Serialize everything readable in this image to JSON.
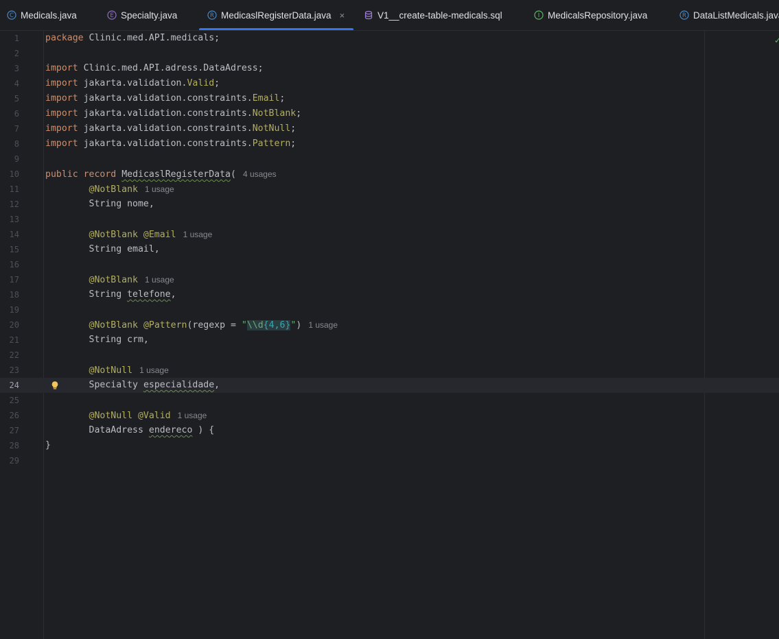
{
  "tabs": [
    {
      "label": "Medicals.java",
      "icon": "class-icon",
      "color": "#4a88c7"
    },
    {
      "label": "Specialty.java",
      "icon": "enum-icon",
      "color": "#8e6fc2"
    },
    {
      "label": "MedicaslRegisterData.java",
      "icon": "record-icon",
      "color": "#4a88c7",
      "active": true,
      "close": "×"
    },
    {
      "label": "V1__create-table-medicals.sql",
      "icon": "database-icon",
      "color": "#9b7ed1"
    },
    {
      "label": "MedicalsRepository.java",
      "icon": "interface-icon",
      "color": "#5fb865"
    },
    {
      "label": "DataListMedicals.java",
      "icon": "record-icon",
      "color": "#4a88c7"
    }
  ],
  "editor": {
    "current_line": 24,
    "line_numbers": [
      "1",
      "2",
      "3",
      "4",
      "5",
      "6",
      "7",
      "8",
      "9",
      "10",
      "11",
      "12",
      "13",
      "14",
      "15",
      "16",
      "17",
      "18",
      "19",
      "20",
      "21",
      "22",
      "23",
      "24",
      "25",
      "26",
      "27",
      "28",
      "29"
    ],
    "hints": {
      "record": "4 usages",
      "one": "1 usage"
    },
    "code": {
      "l1_kw": "package",
      "l1_rest": " Clinic.med.API.medicals;",
      "l3_kw": "import",
      "l3_rest": " Clinic.med.API.adress.DataAdress;",
      "l4_kw": "import",
      "l4_pre": " jakarta.validation.",
      "l4_ann": "Valid",
      "l4_post": ";",
      "l5_kw": "import",
      "l5_pre": " jakarta.validation.constraints.",
      "l5_ann": "Email",
      "l5_post": ";",
      "l6_kw": "import",
      "l6_pre": " jakarta.validation.constraints.",
      "l6_ann": "NotBlank",
      "l6_post": ";",
      "l7_kw": "import",
      "l7_pre": " jakarta.validation.constraints.",
      "l7_ann": "NotNull",
      "l7_post": ";",
      "l8_kw": "import",
      "l8_pre": " jakarta.validation.constraints.",
      "l8_ann": "Pattern",
      "l8_post": ";",
      "l10_kw1": "public",
      "l10_kw2": "record",
      "l10_name": "MedicaslRegisterData",
      "l10_post": "(",
      "l11_ann": "@NotBlank",
      "l12": "String nome,",
      "l14_ann": "@NotBlank @Email",
      "l15": "String email,",
      "l17_ann": "@NotBlank",
      "l18_pre": "String ",
      "l18_var": "telefone",
      "l18_post": ",",
      "l20_ann1": "@NotBlank",
      "l20_ann2": "@Pattern",
      "l20_mid": "(regexp = ",
      "l20_q1": "\"",
      "l20_esc": "\\\\d",
      "l20_b1": "{",
      "l20_n": "4,6",
      "l20_b2": "}",
      "l20_q2": "\"",
      "l20_post": ")",
      "l21": "String crm,",
      "l23_ann": "@NotNull",
      "l24_pre": "Specialty ",
      "l24_var": "especialidade",
      "l24_post": ",",
      "l26_ann": "@NotNull @Valid",
      "l27_pre": "DataAdress ",
      "l27_var": "endereco",
      "l27_post": " ) {",
      "l28": "}"
    }
  },
  "status": {
    "inspection_ok": "✓"
  }
}
